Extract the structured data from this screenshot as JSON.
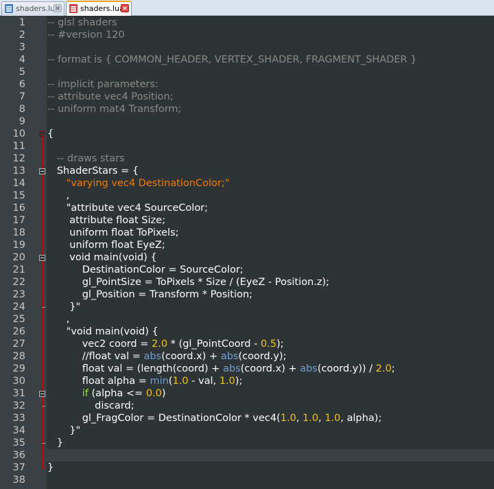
{
  "tabs": [
    {
      "label": "shaders.lua",
      "active": false,
      "icon": "lua-file-icon"
    },
    {
      "label": "shaders.lua",
      "active": true,
      "icon": "lua-file-icon"
    }
  ],
  "editor": {
    "current_line": 36,
    "lines": [
      {
        "n": "1",
        "html": "<span class='c'>-- glsl shaders</span>"
      },
      {
        "n": "2",
        "html": "<span class='c'>-- #version 120</span>"
      },
      {
        "n": "3",
        "html": ""
      },
      {
        "n": "4",
        "html": "<span class='c'>-- format is { COMMON_HEADER, VERTEX_SHADER, FRAGMENT_SHADER }</span>"
      },
      {
        "n": "5",
        "html": ""
      },
      {
        "n": "6",
        "html": "<span class='c'>-- implicit parameters:</span>"
      },
      {
        "n": "7",
        "html": "<span class='c'>-- attribute vec4 Position;</span>"
      },
      {
        "n": "8",
        "html": "<span class='c'>-- uniform mat4 Transform;</span>"
      },
      {
        "n": "9",
        "html": ""
      },
      {
        "n": "10",
        "html": "{"
      },
      {
        "n": "11",
        "html": ""
      },
      {
        "n": "12",
        "html": "   <span class='c'>-- draws stars</span>"
      },
      {
        "n": "13",
        "html": "   ShaderStars = {"
      },
      {
        "n": "14",
        "html": "      <span class='s'>\"varying vec4 DestinationColor;\"</span>"
      },
      {
        "n": "15",
        "html": "      ,"
      },
      {
        "n": "16",
        "html": "      \"attribute vec4 SourceColor;"
      },
      {
        "n": "17",
        "html": "       attribute float Size;"
      },
      {
        "n": "18",
        "html": "       uniform float ToPixels;"
      },
      {
        "n": "19",
        "html": "       uniform float EyeZ;"
      },
      {
        "n": "20",
        "html": "       void main(void) {"
      },
      {
        "n": "21",
        "html": "           DestinationColor = SourceColor;"
      },
      {
        "n": "22",
        "html": "           gl_PointSize = ToPixels * Size / (EyeZ - Position.z);"
      },
      {
        "n": "23",
        "html": "           gl_Position = Transform * Position;"
      },
      {
        "n": "24",
        "html": "       }\""
      },
      {
        "n": "25",
        "html": "      ,"
      },
      {
        "n": "26",
        "html": "      \"void main(void) {"
      },
      {
        "n": "27",
        "html": "           vec2 coord = <span class='n'>2.0</span> * (gl_PointCoord - <span class='n'>0.5</span>);"
      },
      {
        "n": "28",
        "html": "           //float val = <span class='b'>abs</span>(coord.x) + <span class='b'>abs</span>(coord.y);"
      },
      {
        "n": "29",
        "html": "           float val = (length(coord) + <span class='b'>abs</span>(coord.x) + <span class='b'>abs</span>(coord.y)) / <span class='n'>2.0</span>;"
      },
      {
        "n": "30",
        "html": "           float alpha = <span class='b'>min</span>(<span class='n'>1.0</span> - val, <span class='n'>1.0</span>);"
      },
      {
        "n": "31",
        "html": "           <span class='k'>if</span> (alpha &lt;= <span class='n'>0.0</span>)"
      },
      {
        "n": "32",
        "html": "               discard;"
      },
      {
        "n": "33",
        "html": "           gl_FragColor = DestinationColor * vec4(<span class='n'>1.0</span>, <span class='n'>1.0</span>, <span class='n'>1.0</span>, alpha);"
      },
      {
        "n": "34",
        "html": "       }\""
      },
      {
        "n": "35",
        "html": "   }"
      },
      {
        "n": "36",
        "html": ""
      },
      {
        "n": "37",
        "html": "}"
      },
      {
        "n": "38",
        "html": ""
      }
    ]
  },
  "colors": {
    "background": "#2e3436",
    "comment": "#888a85",
    "string": "#f57900",
    "number": "#f0c419",
    "builtin": "#729fcf",
    "keyword": "#8ae234",
    "fold_marker": "#cc0000"
  }
}
